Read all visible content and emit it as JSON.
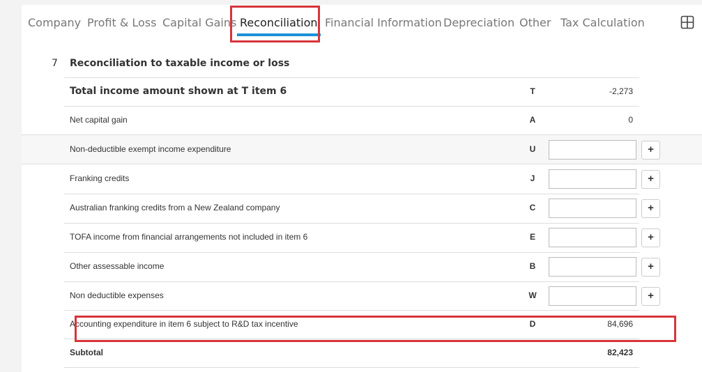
{
  "tabs": [
    {
      "label": "Company"
    },
    {
      "label": "Profit & Loss"
    },
    {
      "label": "Capital Gains"
    },
    {
      "label": "Reconciliation"
    },
    {
      "label": "Financial Information"
    },
    {
      "label": "Depreciation"
    },
    {
      "label": "Other"
    },
    {
      "label": "Tax Calculation"
    }
  ],
  "active_tab": "Reconciliation",
  "accent_color": "#1e90d8",
  "highlight_color": "#d7343b",
  "grid_icon": "grid-icon",
  "section": {
    "number": "7",
    "title": "Reconciliation to taxable income or loss"
  },
  "rows": [
    {
      "label": "Total income amount shown at T item 6",
      "code": "T",
      "value": "-2,273"
    },
    {
      "label": "Net capital gain",
      "code": "A",
      "value": "0"
    },
    {
      "label": "Non-deductible exempt income expenditure",
      "code": "U",
      "value": ""
    },
    {
      "label": "Franking credits",
      "code": "J",
      "value": ""
    },
    {
      "label": "Australian franking credits from a New Zealand company",
      "code": "C",
      "value": ""
    },
    {
      "label": "TOFA income from financial arrangements not included in item 6",
      "code": "E",
      "value": ""
    },
    {
      "label": "Other assessable income",
      "code": "B",
      "value": ""
    },
    {
      "label": "Non deductible expenses",
      "code": "W",
      "value": ""
    },
    {
      "label": "Accounting expenditure in item 6 subject to R&D tax incentive",
      "code": "D",
      "value": "84,696"
    }
  ],
  "subtotal": {
    "label": "Subtotal",
    "value": "82,423"
  },
  "add_button_label": "+"
}
